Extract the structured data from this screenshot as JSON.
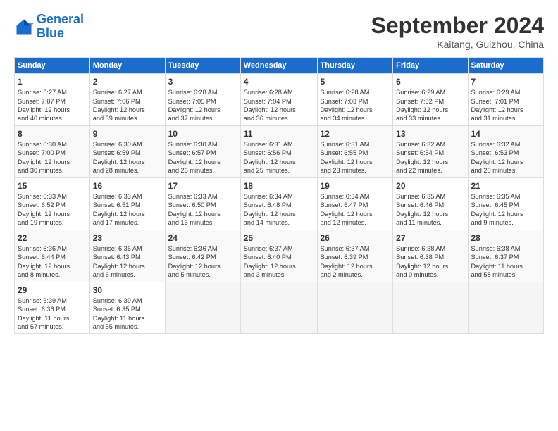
{
  "header": {
    "logo_line1": "General",
    "logo_line2": "Blue",
    "month": "September 2024",
    "location": "Kaitang, Guizhou, China"
  },
  "weekdays": [
    "Sunday",
    "Monday",
    "Tuesday",
    "Wednesday",
    "Thursday",
    "Friday",
    "Saturday"
  ],
  "weeks": [
    [
      {
        "day": "1",
        "info": "Sunrise: 6:27 AM\nSunset: 7:07 PM\nDaylight: 12 hours\nand 40 minutes."
      },
      {
        "day": "2",
        "info": "Sunrise: 6:27 AM\nSunset: 7:06 PM\nDaylight: 12 hours\nand 39 minutes."
      },
      {
        "day": "3",
        "info": "Sunrise: 6:28 AM\nSunset: 7:05 PM\nDaylight: 12 hours\nand 37 minutes."
      },
      {
        "day": "4",
        "info": "Sunrise: 6:28 AM\nSunset: 7:04 PM\nDaylight: 12 hours\nand 36 minutes."
      },
      {
        "day": "5",
        "info": "Sunrise: 6:28 AM\nSunset: 7:03 PM\nDaylight: 12 hours\nand 34 minutes."
      },
      {
        "day": "6",
        "info": "Sunrise: 6:29 AM\nSunset: 7:02 PM\nDaylight: 12 hours\nand 33 minutes."
      },
      {
        "day": "7",
        "info": "Sunrise: 6:29 AM\nSunset: 7:01 PM\nDaylight: 12 hours\nand 31 minutes."
      }
    ],
    [
      {
        "day": "8",
        "info": "Sunrise: 6:30 AM\nSunset: 7:00 PM\nDaylight: 12 hours\nand 30 minutes."
      },
      {
        "day": "9",
        "info": "Sunrise: 6:30 AM\nSunset: 6:59 PM\nDaylight: 12 hours\nand 28 minutes."
      },
      {
        "day": "10",
        "info": "Sunrise: 6:30 AM\nSunset: 6:57 PM\nDaylight: 12 hours\nand 26 minutes."
      },
      {
        "day": "11",
        "info": "Sunrise: 6:31 AM\nSunset: 6:56 PM\nDaylight: 12 hours\nand 25 minutes."
      },
      {
        "day": "12",
        "info": "Sunrise: 6:31 AM\nSunset: 6:55 PM\nDaylight: 12 hours\nand 23 minutes."
      },
      {
        "day": "13",
        "info": "Sunrise: 6:32 AM\nSunset: 6:54 PM\nDaylight: 12 hours\nand 22 minutes."
      },
      {
        "day": "14",
        "info": "Sunrise: 6:32 AM\nSunset: 6:53 PM\nDaylight: 12 hours\nand 20 minutes."
      }
    ],
    [
      {
        "day": "15",
        "info": "Sunrise: 6:33 AM\nSunset: 6:52 PM\nDaylight: 12 hours\nand 19 minutes."
      },
      {
        "day": "16",
        "info": "Sunrise: 6:33 AM\nSunset: 6:51 PM\nDaylight: 12 hours\nand 17 minutes."
      },
      {
        "day": "17",
        "info": "Sunrise: 6:33 AM\nSunset: 6:50 PM\nDaylight: 12 hours\nand 16 minutes."
      },
      {
        "day": "18",
        "info": "Sunrise: 6:34 AM\nSunset: 6:48 PM\nDaylight: 12 hours\nand 14 minutes."
      },
      {
        "day": "19",
        "info": "Sunrise: 6:34 AM\nSunset: 6:47 PM\nDaylight: 12 hours\nand 12 minutes."
      },
      {
        "day": "20",
        "info": "Sunrise: 6:35 AM\nSunset: 6:46 PM\nDaylight: 12 hours\nand 11 minutes."
      },
      {
        "day": "21",
        "info": "Sunrise: 6:35 AM\nSunset: 6:45 PM\nDaylight: 12 hours\nand 9 minutes."
      }
    ],
    [
      {
        "day": "22",
        "info": "Sunrise: 6:36 AM\nSunset: 6:44 PM\nDaylight: 12 hours\nand 8 minutes."
      },
      {
        "day": "23",
        "info": "Sunrise: 6:36 AM\nSunset: 6:43 PM\nDaylight: 12 hours\nand 6 minutes."
      },
      {
        "day": "24",
        "info": "Sunrise: 6:36 AM\nSunset: 6:42 PM\nDaylight: 12 hours\nand 5 minutes."
      },
      {
        "day": "25",
        "info": "Sunrise: 6:37 AM\nSunset: 6:40 PM\nDaylight: 12 hours\nand 3 minutes."
      },
      {
        "day": "26",
        "info": "Sunrise: 6:37 AM\nSunset: 6:39 PM\nDaylight: 12 hours\nand 2 minutes."
      },
      {
        "day": "27",
        "info": "Sunrise: 6:38 AM\nSunset: 6:38 PM\nDaylight: 12 hours\nand 0 minutes."
      },
      {
        "day": "28",
        "info": "Sunrise: 6:38 AM\nSunset: 6:37 PM\nDaylight: 11 hours\nand 58 minutes."
      }
    ],
    [
      {
        "day": "29",
        "info": "Sunrise: 6:39 AM\nSunset: 6:36 PM\nDaylight: 11 hours\nand 57 minutes."
      },
      {
        "day": "30",
        "info": "Sunrise: 6:39 AM\nSunset: 6:35 PM\nDaylight: 11 hours\nand 55 minutes."
      },
      null,
      null,
      null,
      null,
      null
    ]
  ]
}
